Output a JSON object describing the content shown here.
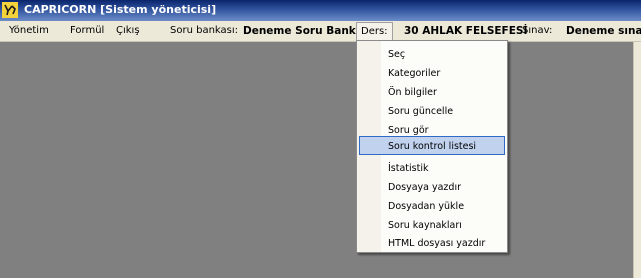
{
  "window": {
    "title": "CAPRICORN [Sistem yöneticisi]"
  },
  "menubar": {
    "items": [
      {
        "label": "Yönetim"
      },
      {
        "label": "Formül"
      },
      {
        "label": "Çıkış"
      },
      {
        "label": "Soru bankası:"
      },
      {
        "label": "Deneme Soru Bankası"
      },
      {
        "label": "Ders:"
      },
      {
        "label": "30  AHLAK FELSEFESİ"
      },
      {
        "label": "Sınav:"
      },
      {
        "label": "Deneme sınavı"
      }
    ]
  },
  "dropdown": {
    "items": [
      {
        "label": "Seç"
      },
      {
        "label": "Kategoriler"
      },
      {
        "label": "Ön bilgiler"
      },
      {
        "label": "Soru güncelle"
      },
      {
        "label": "Soru gör"
      },
      {
        "label": "Soru kontrol listesi"
      },
      {
        "label": "İstatistik"
      },
      {
        "label": "Dosyaya yazdır"
      },
      {
        "label": "Dosyadan yükle"
      },
      {
        "label": "Soru kaynakları"
      },
      {
        "label": "HTML dosyası yazdır"
      }
    ],
    "highlighted_index": 5
  },
  "colors": {
    "titlebar": "#0a246a",
    "menubar": "#ece9d8",
    "client": "#808080",
    "highlight": "#c1d2ee"
  }
}
